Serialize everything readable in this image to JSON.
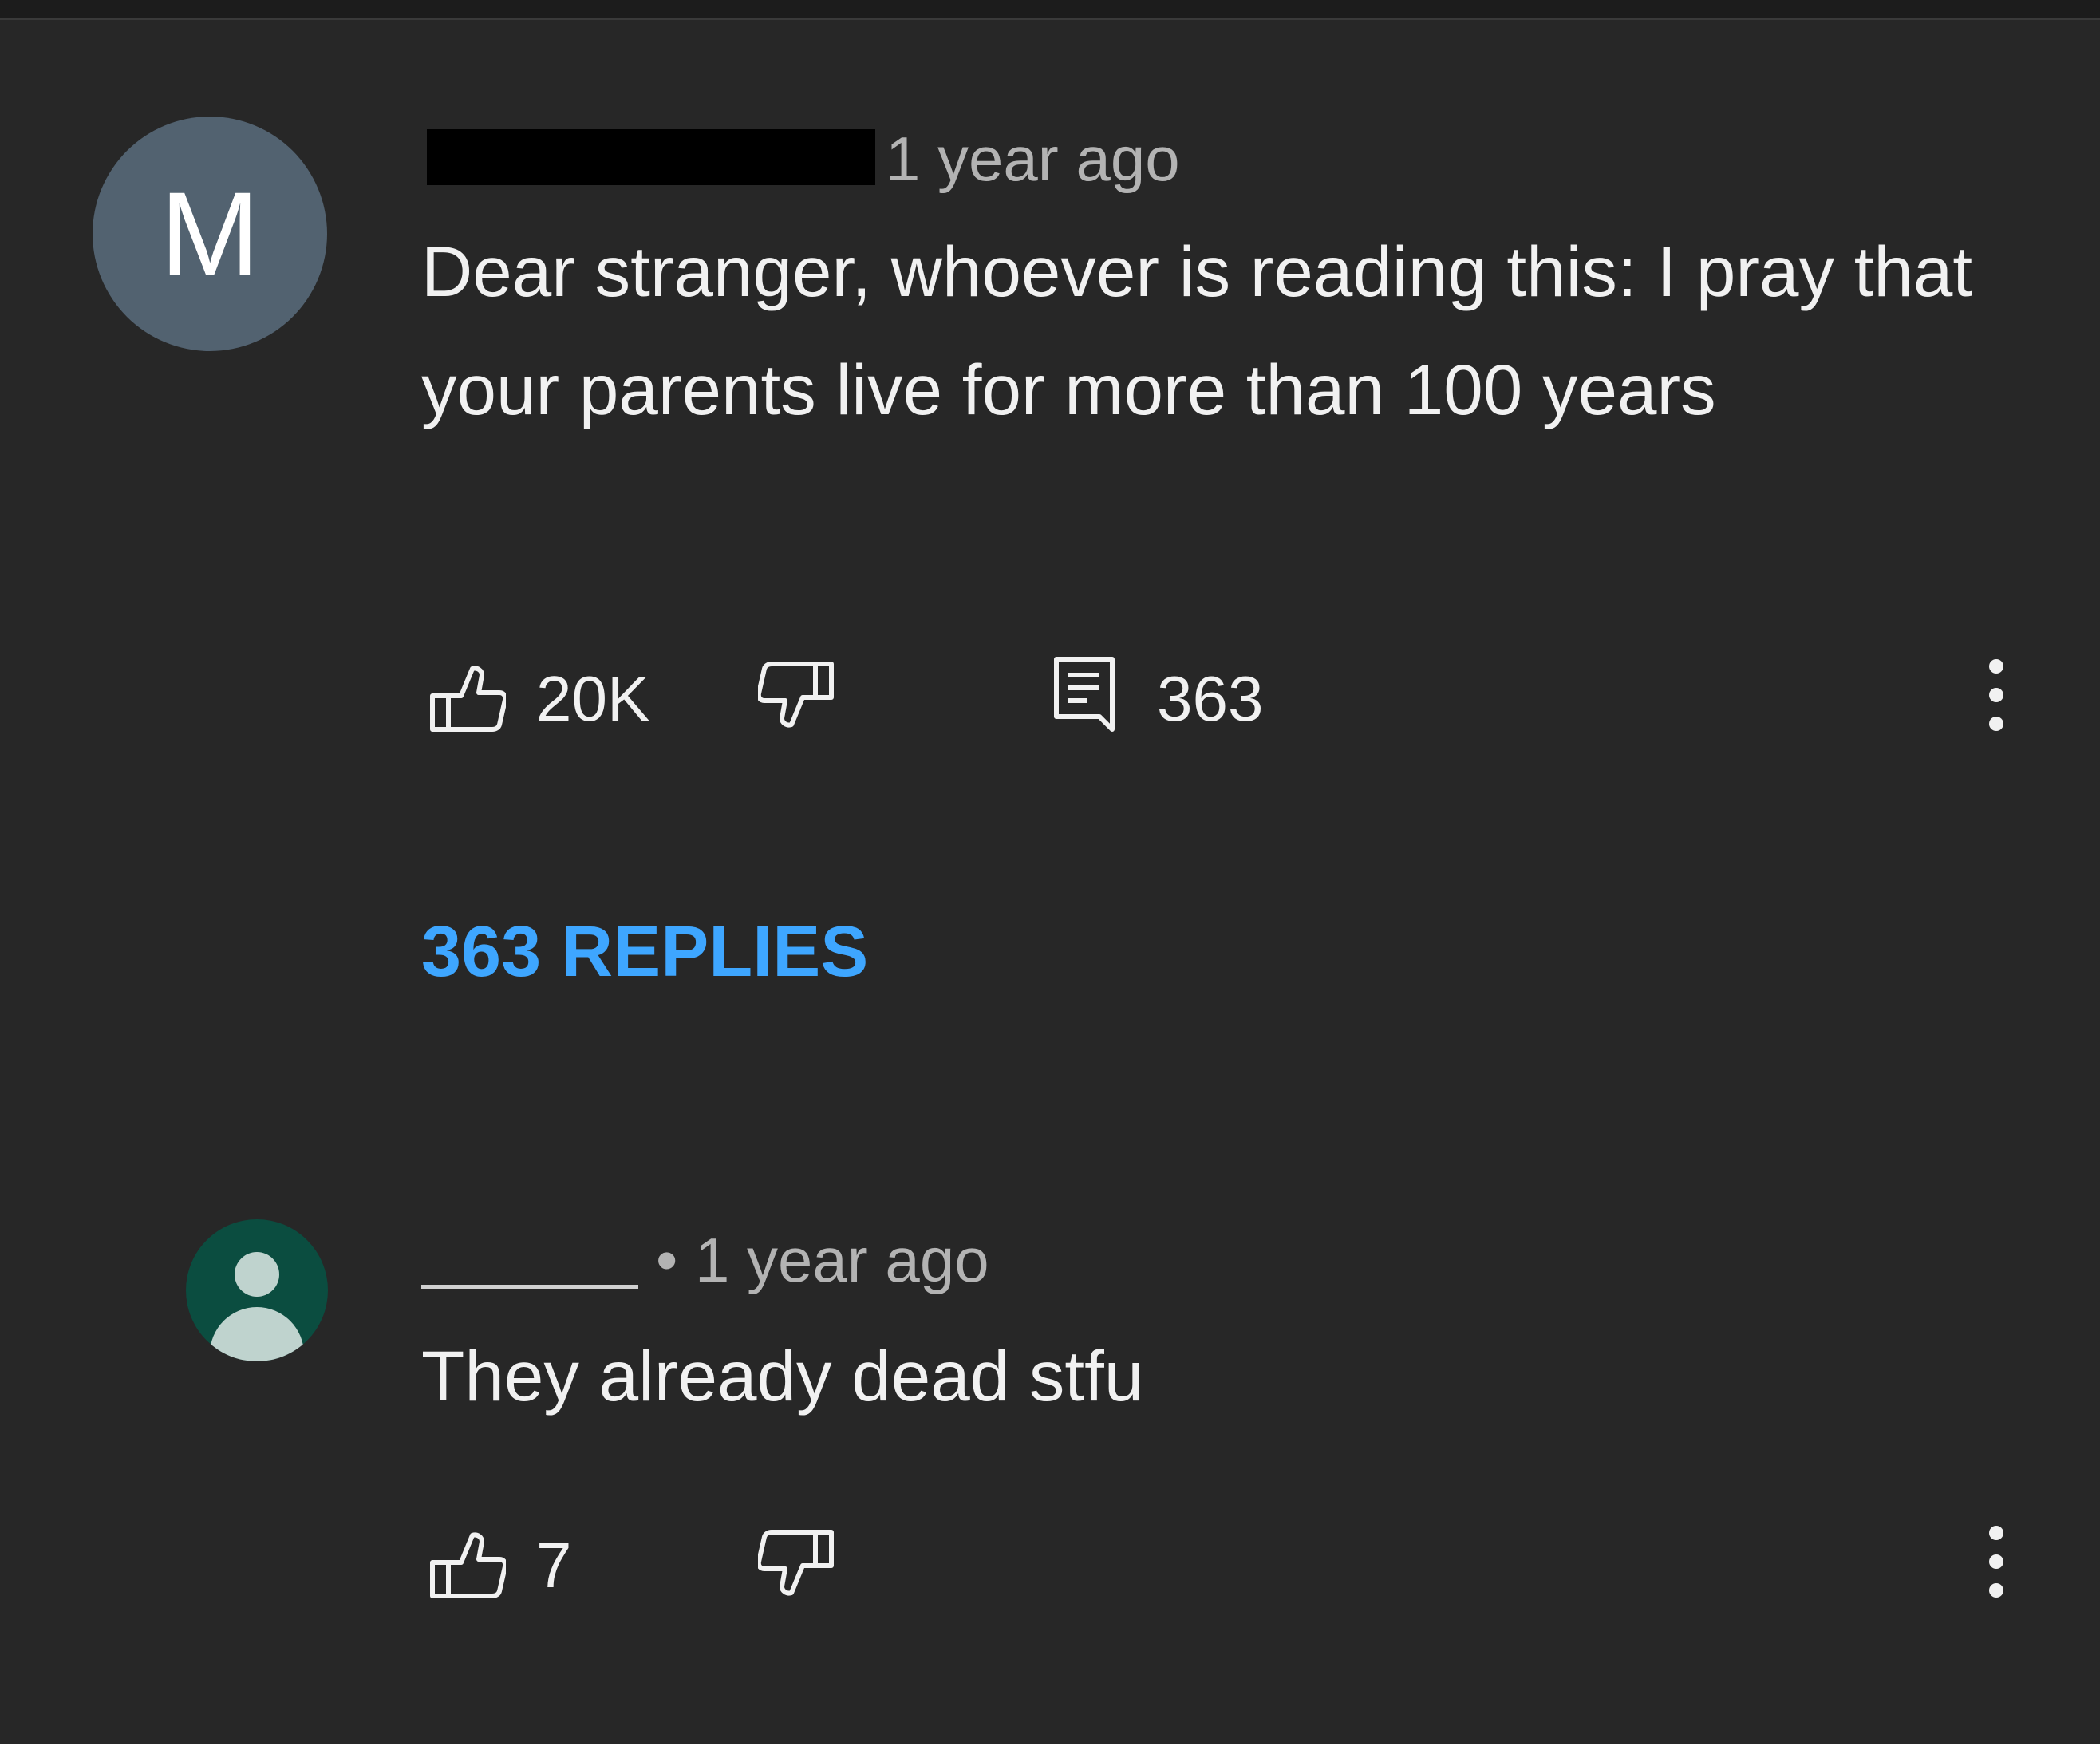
{
  "theme": {
    "background": "#272727",
    "text_primary": "#f1f1f1",
    "text_secondary": "#b3b3b3",
    "link": "#3ea6ff",
    "avatar_1_color": "#526270",
    "avatar_2_color": "#0b4d40"
  },
  "comments": [
    {
      "avatar_letter": "M",
      "username_redacted": true,
      "timestamp": "1 year ago",
      "text": "Dear stranger, whoever is reading this: I pray that your parents live for more than 100 years",
      "likes": "20K",
      "reply_count": "363",
      "replies_link": "363 REPLIES",
      "icons": [
        "thumbs-up-icon",
        "thumbs-down-icon",
        "comment-icon",
        "more-vert-icon"
      ]
    },
    {
      "avatar_icon": "person-icon",
      "username_redacted": true,
      "timestamp": "• 1 year ago",
      "text": "They already dead stfu",
      "likes": "7",
      "icons": [
        "thumbs-up-icon",
        "thumbs-down-icon",
        "more-vert-icon"
      ]
    }
  ]
}
